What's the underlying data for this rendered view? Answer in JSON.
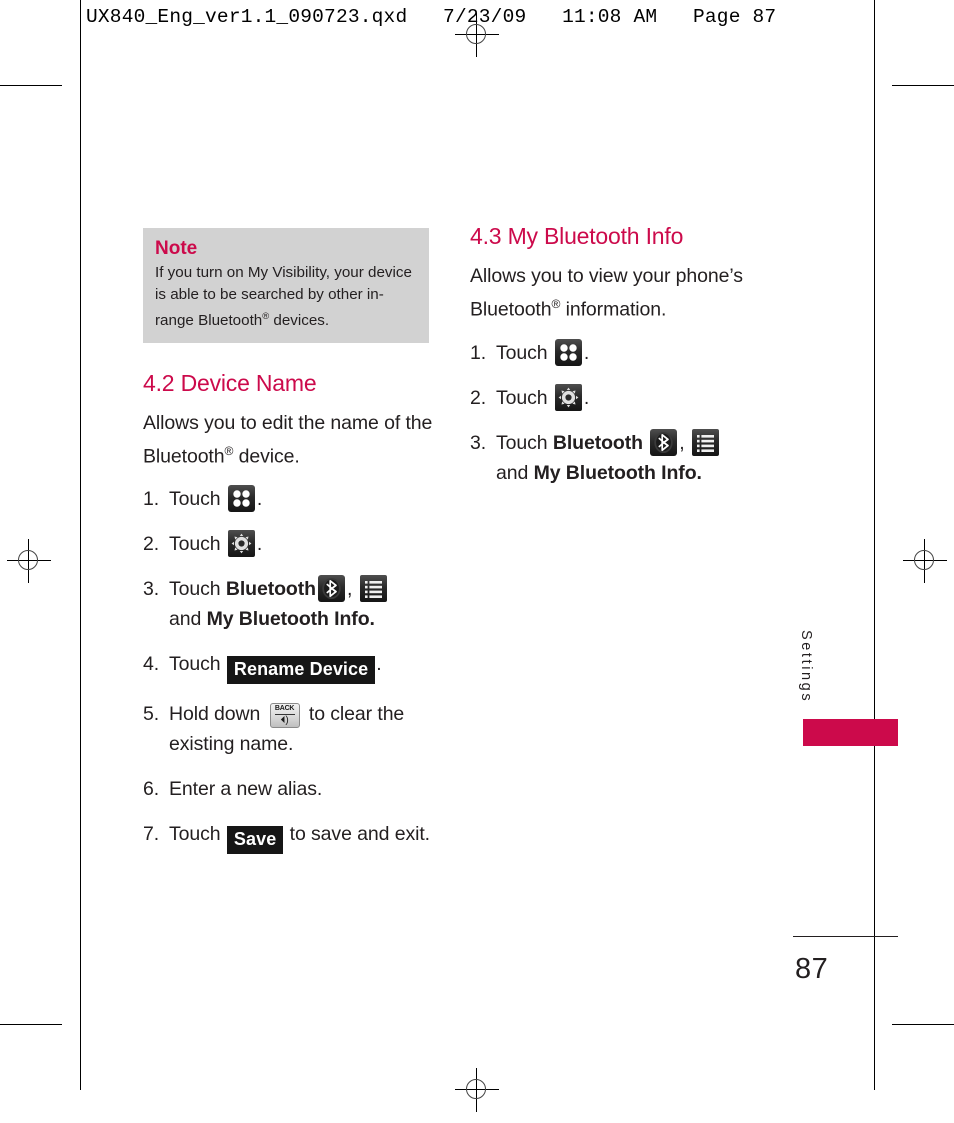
{
  "document": {
    "header_line": "UX840_Eng_ver1.1_090723.qxd   7/23/09   11:08 AM   Page 87",
    "page_number": "87",
    "side_tab_label": "Settings",
    "accent_color": "#cc0a4b",
    "note_bg_color": "#d2d2d2"
  },
  "note": {
    "title": "Note",
    "body_line1": "If you turn on My Visibility, your",
    "body_line2": "device is able to be searched by",
    "body_line3_pre": "other in-range Bluetooth",
    "body_line3_sup": "®",
    "body_line3_post": " devices."
  },
  "left_column": {
    "section_number_title": "4.2 Device Name",
    "intro_pre": "Allows you to edit the name of the Bluetooth",
    "intro_sup": "®",
    "intro_post": " device.",
    "steps": [
      {
        "num": "1.",
        "text_before": "Touch",
        "icon": "grid-apps-icon",
        "text_after": "."
      },
      {
        "num": "2.",
        "text_before": "Touch",
        "icon": "gear-settings-icon",
        "text_after": "."
      },
      {
        "num": "3.",
        "text_before": "Touch",
        "bold_label": "Bluetooth",
        "icon_1": "bluetooth-icon",
        "separator": ",",
        "icon_2": "list-menu-icon",
        "text_second_line": "and",
        "bold_label_2": "My Bluetooth Info."
      },
      {
        "num": "4.",
        "text_before": "Touch",
        "chip": "Rename Device",
        "text_after": "."
      },
      {
        "num": "5.",
        "text_before": "Hold down",
        "key_label": "BACK",
        "key_glyph": "⏴)",
        "text_after": "to clear the",
        "text_second_line": "existing name."
      },
      {
        "num": "6.",
        "text_before": "Enter a new alias."
      },
      {
        "num": "7.",
        "text_before": "Touch",
        "chip": "Save",
        "text_after": "to save and exit."
      }
    ]
  },
  "right_column": {
    "section_number_title": "4.3 My Bluetooth Info",
    "intro_pre": "Allows you to view your phone’s Bluetooth",
    "intro_sup": "®",
    "intro_post": " information.",
    "steps": [
      {
        "num": "1.",
        "text_before": "Touch",
        "icon": "grid-apps-icon",
        "text_after": "."
      },
      {
        "num": "2.",
        "text_before": "Touch",
        "icon": "gear-settings-icon",
        "text_after": "."
      },
      {
        "num": "3.",
        "text_before": "Touch",
        "bold_label": "Bluetooth",
        "icon_1": "bluetooth-icon",
        "separator": ",",
        "icon_2": "list-menu-icon",
        "text_second_line": "and",
        "bold_label_2": "My Bluetooth Info."
      }
    ]
  }
}
